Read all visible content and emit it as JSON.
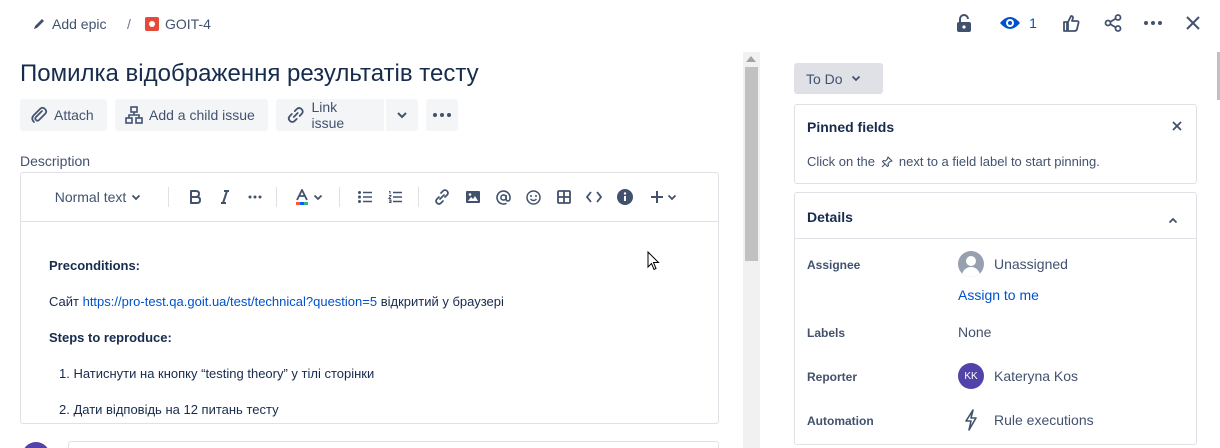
{
  "breadcrumb": {
    "add_epic": "Add epic",
    "separator": "/",
    "issue_key": "GOIT-4"
  },
  "toolbar": {
    "watch_count": "1"
  },
  "issue": {
    "title": "Помилка відображення результатів тесту"
  },
  "actions": {
    "attach": "Attach",
    "add_child": "Add a child issue",
    "link_issue": "Link issue"
  },
  "description": {
    "label": "Description",
    "text_style": "Normal text",
    "preconditions_heading": "Preconditions:",
    "site_prefix": "Сайт ",
    "site_url": "https://pro-test.qa.goit.ua/test/technical?question=5",
    "site_suffix": " відкритий у браузері",
    "steps_heading": "Steps to reproduce:",
    "step1": "1. Натиснути на кнопку “testing theory” у тілі сторінки",
    "step2": "2. Дати відповідь на 12 питань тесту"
  },
  "status": {
    "label": "To Do"
  },
  "pinned": {
    "title": "Pinned fields",
    "text_before": "Click on the",
    "text_after": "next to a field label to start pinning."
  },
  "details": {
    "title": "Details",
    "assignee_label": "Assignee",
    "assignee_value": "Unassigned",
    "assign_to_me": "Assign to me",
    "labels_label": "Labels",
    "labels_value": "None",
    "reporter_label": "Reporter",
    "reporter_initials": "KK",
    "reporter_value": "Kateryna Kos",
    "automation_label": "Automation",
    "automation_value": "Rule executions"
  },
  "colors": {
    "link": "#0052cc",
    "text": "#172b4d",
    "subtle": "#42526e",
    "issue_type": "#e5493a",
    "avatar": "#5243aa"
  },
  "icons": [
    "pencil-icon",
    "bug-icon",
    "unlock-icon",
    "eye-icon",
    "thumbs-up-icon",
    "share-icon",
    "more-icon",
    "close-icon",
    "paperclip-icon",
    "hierarchy-icon",
    "link-icon",
    "chevron-down-icon",
    "bold-icon",
    "italic-icon",
    "text-color-icon",
    "bullet-list-icon",
    "numbered-list-icon",
    "image-icon",
    "mention-icon",
    "emoji-icon",
    "table-icon",
    "code-icon",
    "info-icon",
    "plus-icon",
    "pin-icon",
    "chevron-up-icon",
    "lightning-icon"
  ]
}
